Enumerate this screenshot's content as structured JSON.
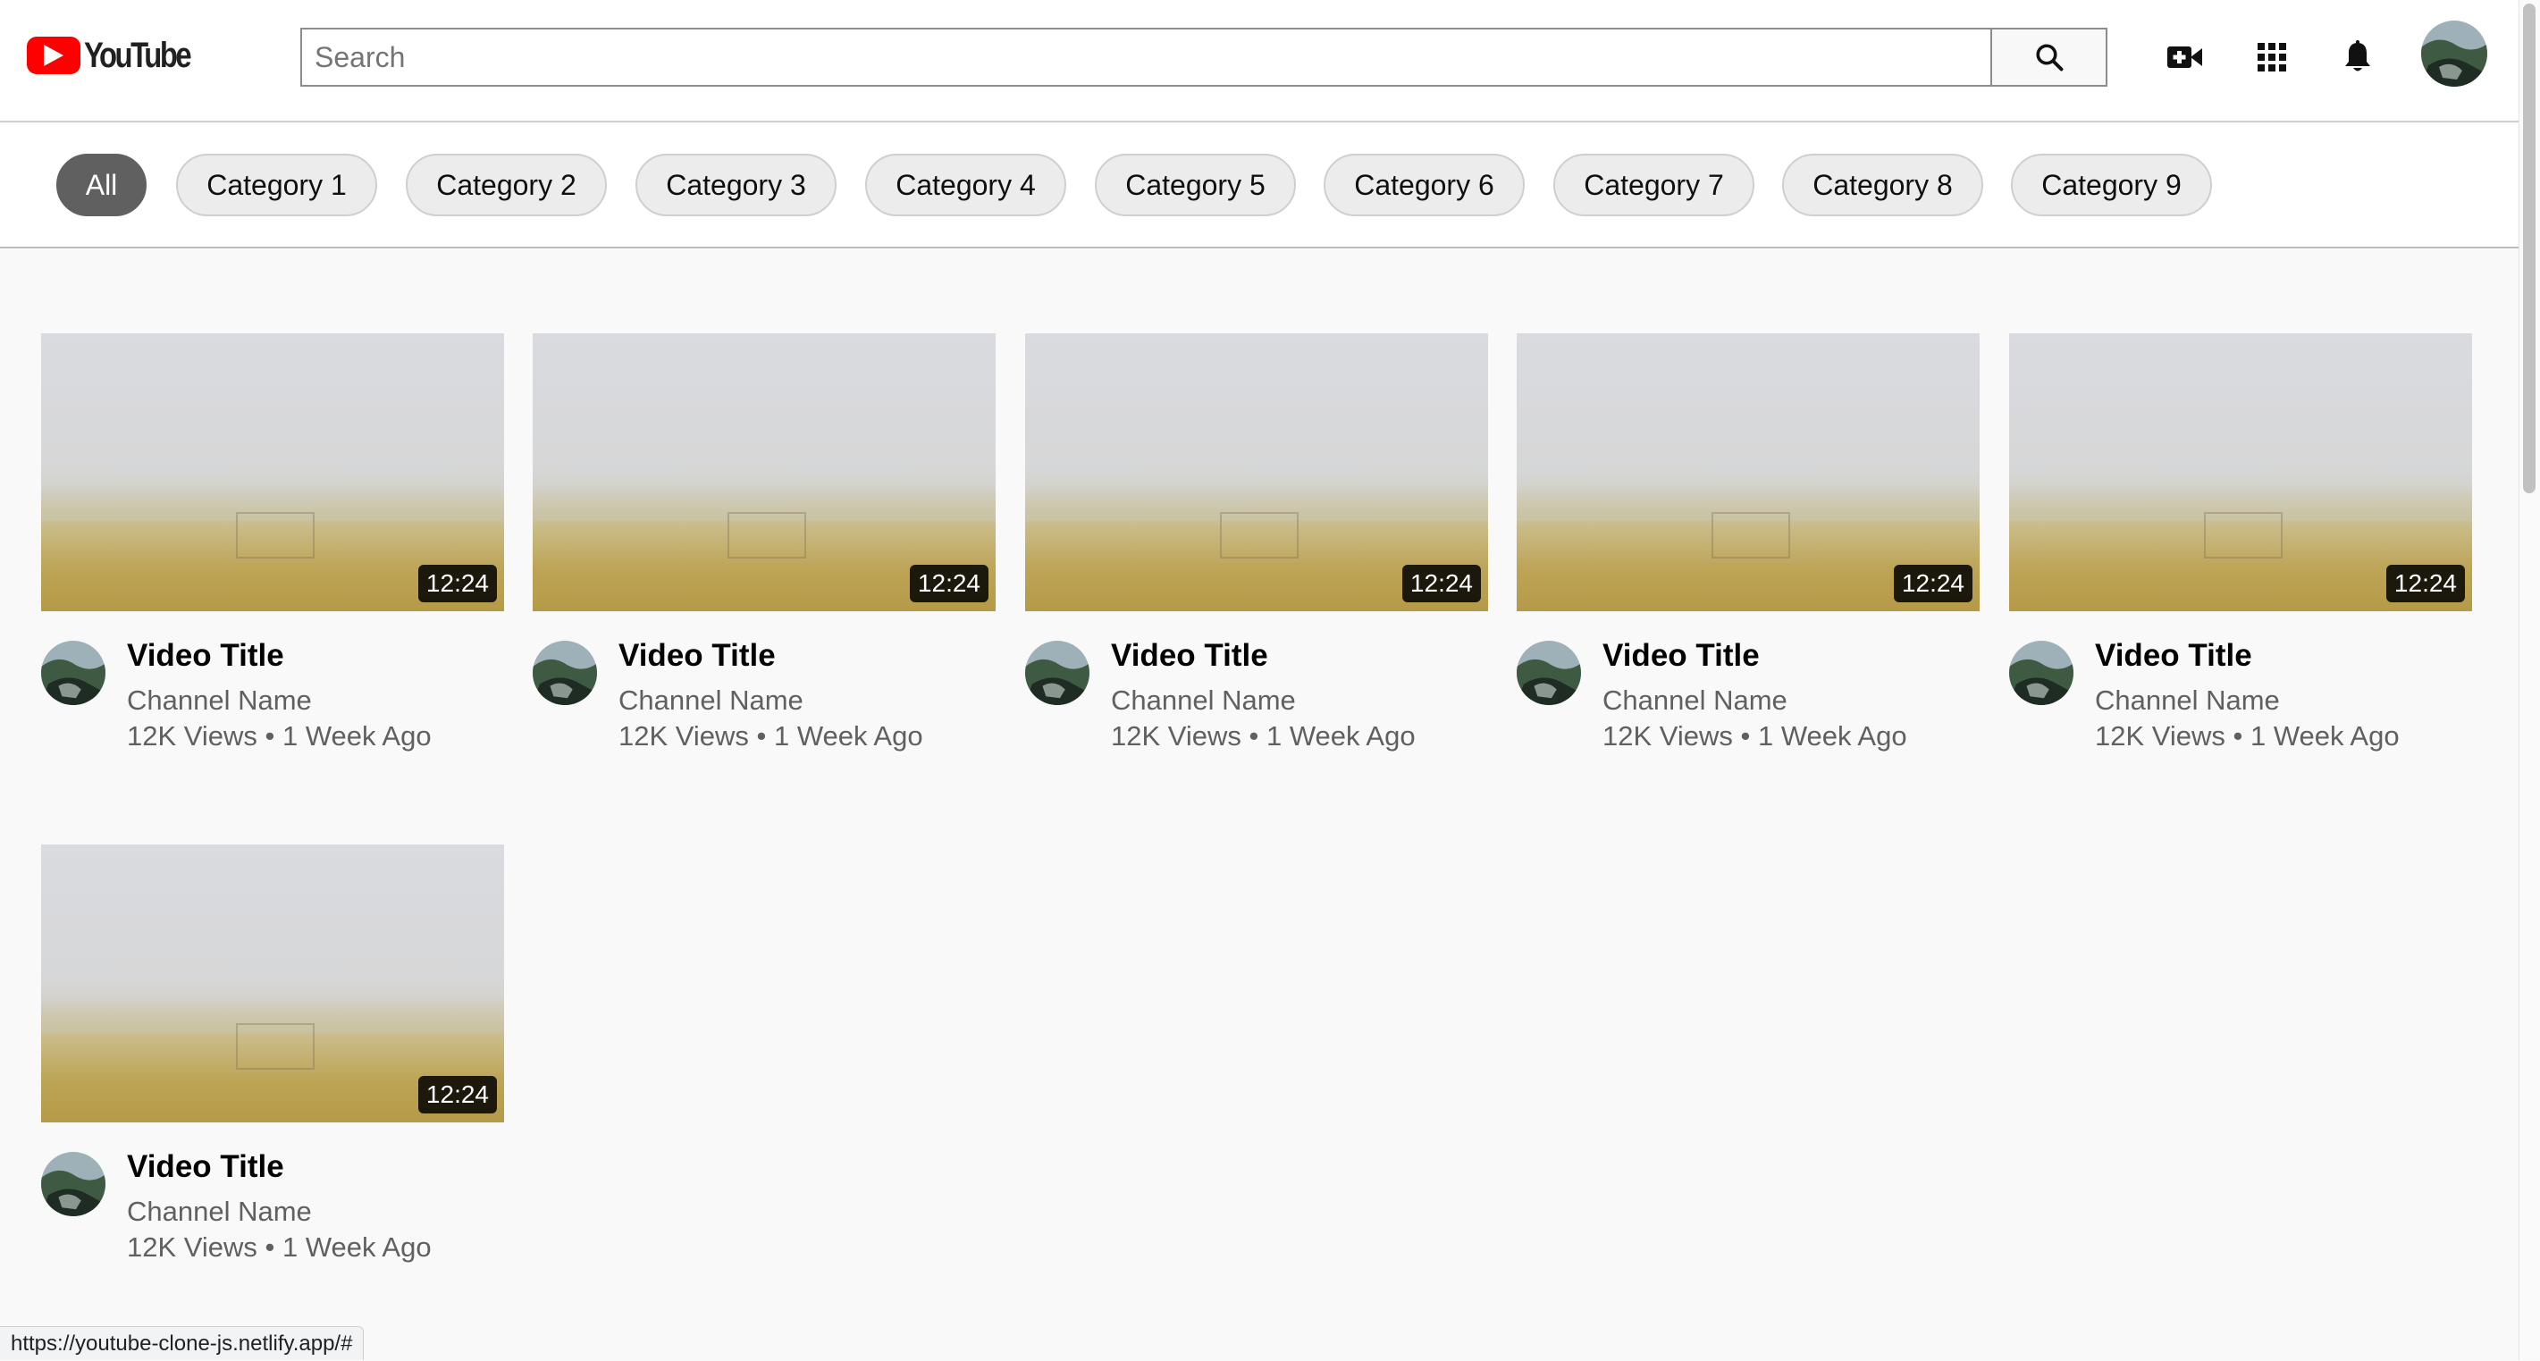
{
  "header": {
    "logo_text": "YouTube",
    "search_placeholder": "Search",
    "icons": [
      "search-icon",
      "video-camera-add-icon",
      "apps-grid-icon",
      "bell-icon",
      "avatar"
    ]
  },
  "categories": [
    {
      "label": "All",
      "active": true
    },
    {
      "label": "Category 1"
    },
    {
      "label": "Category 2"
    },
    {
      "label": "Category 3"
    },
    {
      "label": "Category 4"
    },
    {
      "label": "Category 5"
    },
    {
      "label": "Category 6"
    },
    {
      "label": "Category 7"
    },
    {
      "label": "Category 8"
    },
    {
      "label": "Category 9"
    }
  ],
  "videos": [
    {
      "title": "Video Title",
      "channel": "Channel Name",
      "meta": "12K Views • 1 Week Ago",
      "duration": "12:24"
    },
    {
      "title": "Video Title",
      "channel": "Channel Name",
      "meta": "12K Views • 1 Week Ago",
      "duration": "12:24"
    },
    {
      "title": "Video Title",
      "channel": "Channel Name",
      "meta": "12K Views • 1 Week Ago",
      "duration": "12:24"
    },
    {
      "title": "Video Title",
      "channel": "Channel Name",
      "meta": "12K Views • 1 Week Ago",
      "duration": "12:24"
    },
    {
      "title": "Video Title",
      "channel": "Channel Name",
      "meta": "12K Views • 1 Week Ago",
      "duration": "12:24"
    },
    {
      "title": "Video Title",
      "channel": "Channel Name",
      "meta": "12K Views • 1 Week Ago",
      "duration": "12:24"
    }
  ],
  "status_bar": {
    "url": "https://youtube-clone-js.netlify.app/#"
  },
  "colors": {
    "brand_red": "#ff0000",
    "chip_active": "#606060",
    "chip_bg": "#ececec"
  }
}
